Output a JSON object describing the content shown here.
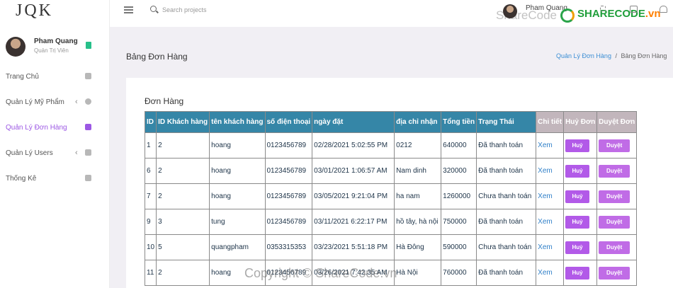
{
  "brand": {
    "logo": "JQK"
  },
  "sidebar": {
    "profile": {
      "name": "Pham Quang",
      "role": "Quản Trị Viên"
    },
    "items": [
      {
        "label": "Trang Chủ",
        "icon": "home-icon",
        "has_chevron": false,
        "chevron": ""
      },
      {
        "label": "Quản Lý Mỹ Phẩm",
        "icon": "target-icon",
        "has_chevron": true,
        "chevron": "‹"
      },
      {
        "label": "Quản Lý Đơn Hàng",
        "icon": "list-icon",
        "has_chevron": false,
        "chevron": "",
        "active": true
      },
      {
        "label": "Quản Lý Users",
        "icon": "briefcase-icon",
        "has_chevron": true,
        "chevron": "‹"
      },
      {
        "label": "Thống Kê",
        "icon": "bar-chart-icon",
        "has_chevron": false,
        "chevron": ""
      }
    ]
  },
  "topbar": {
    "search_placeholder": "Search projects",
    "user_name": "Pham Quang",
    "watermark": "ShareCode",
    "sharecode_logo_main": "SHARECODE",
    "sharecode_logo_suffix": ".vn"
  },
  "header": {
    "title": "Bảng Đơn Hàng",
    "breadcrumb": {
      "link": "Quản Lý Đơn Hàng",
      "separator": "/",
      "current": "Bảng Đơn Hàng"
    }
  },
  "orders": {
    "title": "Đơn Hàng",
    "columns": [
      "ID",
      "ID Khách hàng",
      "tên khách hàng",
      "số điện thoại",
      "ngày đặt",
      "địa chỉ nhận",
      "Tổng tiền",
      "Trạng Thái",
      "Chi tiết",
      "Huỷ Đơn",
      "Duyệt Đơn"
    ],
    "detail_label": "Xem",
    "cancel_label": "Huỷ",
    "approve_label": "Duyệt",
    "rows": [
      [
        "1",
        "2",
        "hoang",
        "0123456789",
        "02/28/2021 5:02:55 PM",
        "0212",
        "640000",
        "Đã thanh toán"
      ],
      [
        "6",
        "2",
        "hoang",
        "0123456789",
        "03/01/2021 1:06:57 AM",
        "Nam dinh",
        "320000",
        "Đã thanh toán"
      ],
      [
        "7",
        "2",
        "hoang",
        "0123456789",
        "03/05/2021 9:21:04 PM",
        "ha nam",
        "1260000",
        "Chưa thanh toán"
      ],
      [
        "9",
        "3",
        "tung",
        "0123456789",
        "03/11/2021 6:22:17 PM",
        "hồ tây, hà nội",
        "750000",
        "Đã thanh toán"
      ],
      [
        "10",
        "5",
        "quangpham",
        "0353315353",
        "03/23/2021 5:51:18 PM",
        "Hà Đông",
        "590000",
        "Chưa thanh toán"
      ],
      [
        "11",
        "2",
        "hoang",
        "0123456789",
        "03/26/2021 7:42:35 AM",
        "Hà Nội",
        "760000",
        "Đã thanh toán"
      ]
    ]
  },
  "footer_watermark": "Copyright © ShareCode.vn",
  "colors": {
    "header_blue": "#3586a7",
    "accent_purple": "#9c58e4",
    "link_blue": "#2f7fc8"
  }
}
